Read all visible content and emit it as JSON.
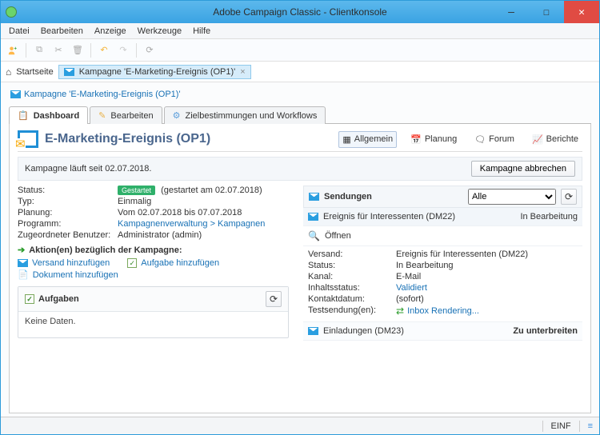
{
  "title": "Adobe Campaign Classic -  Clientkonsole",
  "menubar": {
    "file": "Datei",
    "edit": "Bearbeiten",
    "view": "Anzeige",
    "tools": "Werkzeuge",
    "help": "Hilfe"
  },
  "navbar": {
    "home": "Startseite",
    "tab": "Kampagne 'E-Marketing-Ereignis (OP1)'"
  },
  "breadcrumb": "Kampagne 'E-Marketing-Ereignis (OP1)'",
  "mainTabs": {
    "dashboard": "Dashboard",
    "edit": "Bearbeiten",
    "targeting": "Zielbestimmungen und Workflows"
  },
  "header": {
    "title": "E-Marketing-Ereignis (OP1)",
    "subnav": {
      "general": "Allgemein",
      "planning": "Planung",
      "forum": "Forum",
      "reports": "Berichte"
    }
  },
  "statusLine": {
    "text": "Kampagne läuft seit 02.07.2018.",
    "cancelBtn": "Kampagne abbrechen"
  },
  "info": {
    "labels": {
      "status": "Status:",
      "type": "Typ:",
      "planning": "Planung:",
      "program": "Programm:",
      "owner": "Zugeordneter Benutzer:"
    },
    "values": {
      "statusBadge": "Gestartet",
      "statusText": "  (gestartet am 02.07.2018)",
      "type": "Einmalig",
      "planning": "Vom 02.07.2018 bis 07.07.2018",
      "program": "Kampagnenverwaltung > Kampagnen",
      "owner": "Administrator (admin)"
    }
  },
  "campaignActions": {
    "header": "Aktion(en) bezüglich der Kampagne:",
    "addDelivery": "Versand hinzufügen",
    "addTask": "Aufgabe hinzufügen",
    "addDocument": "Dokument hinzufügen"
  },
  "tasksBox": {
    "header": "Aufgaben",
    "body": "Keine Daten."
  },
  "deliveries": {
    "header": "Sendungen",
    "filterOptions": [
      "Alle"
    ],
    "filterSelected": "Alle",
    "rows": [
      {
        "label": "Ereignis für Interessenten (DM22)",
        "status": "In Bearbeitung"
      },
      {
        "label": "Einladungen (DM23)",
        "status": "Zu unterbreiten"
      }
    ],
    "openLabel": "Öffnen",
    "detail": {
      "labels": {
        "delivery": "Versand:",
        "status": "Status:",
        "channel": "Kanal:",
        "contentStatus": "Inhaltsstatus:",
        "contactDate": "Kontaktdatum:",
        "testSends": "Testsendung(en):"
      },
      "values": {
        "delivery": "Ereignis für Interessenten (DM22)",
        "status": "In Bearbeitung",
        "channel": "E-Mail",
        "contentStatus": "Validiert",
        "contactDate": "(sofort)",
        "testSends": "Inbox Rendering..."
      }
    }
  },
  "statusbar": {
    "mode": "EINF"
  }
}
